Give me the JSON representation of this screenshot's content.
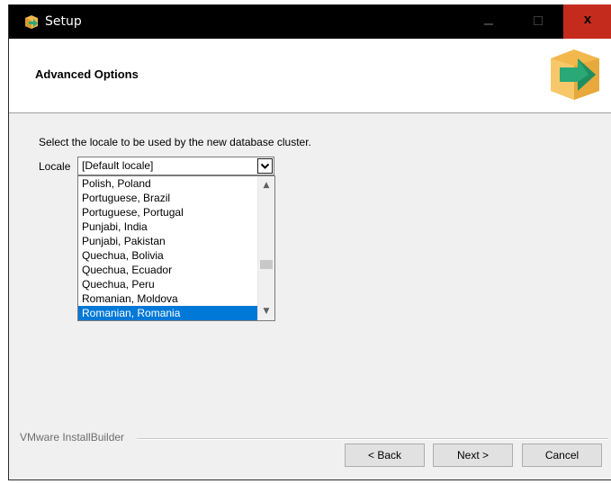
{
  "window": {
    "title": "Setup"
  },
  "title_buttons": {
    "close_label": "x"
  },
  "header": {
    "title": "Advanced Options"
  },
  "content": {
    "instruction": "Select the locale to be used by the new database cluster.",
    "locale_label": "Locale",
    "locale_selected": "[Default locale]",
    "dropdown_items": [
      "Polish, Poland",
      "Portuguese, Brazil",
      "Portuguese, Portugal",
      "Punjabi, India",
      "Punjabi, Pakistan",
      "Quechua, Bolivia",
      "Quechua, Ecuador",
      "Quechua, Peru",
      "Romanian, Moldova",
      "Romanian, Romania"
    ],
    "highlighted_item": "Romanian, Romania"
  },
  "footer": {
    "brand": "VMware InstallBuilder",
    "back_label": "< Back",
    "next_label": "Next >",
    "cancel_label": "Cancel"
  },
  "colors": {
    "titlebar": "#000000",
    "close_button": "#c42b1c",
    "selection": "#0078d7",
    "logo_box": "#f2b84b",
    "logo_arrow": "#2aa876"
  },
  "icons": {
    "app": "setup-box-icon",
    "logo": "installer-box-arrow-icon",
    "dropdown": "chevron-down-icon"
  }
}
